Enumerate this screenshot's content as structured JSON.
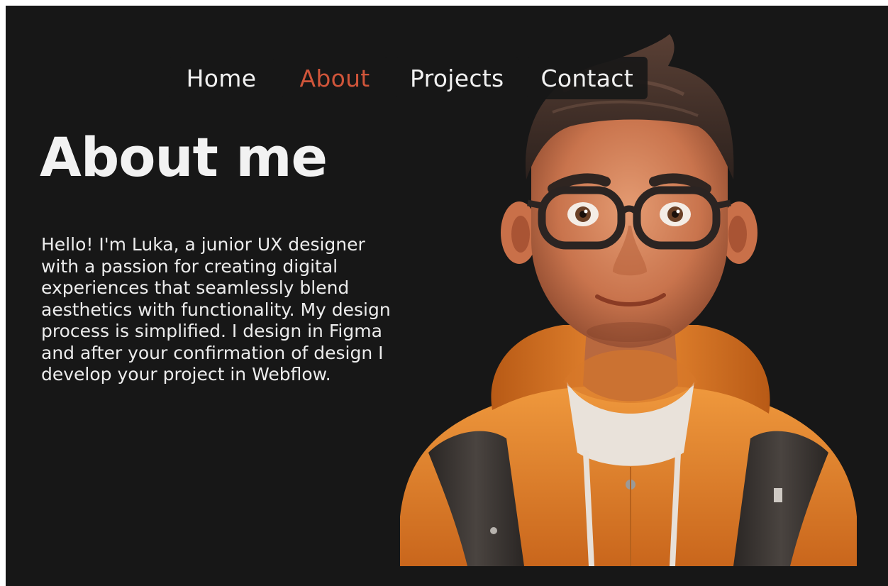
{
  "nav": {
    "items": [
      {
        "label": "Home",
        "active": false
      },
      {
        "label": "About",
        "active": true
      },
      {
        "label": "Projects",
        "active": false
      },
      {
        "label": "Contact",
        "active": false
      }
    ]
  },
  "hero": {
    "title": "About me",
    "bio": "Hello! I'm Luka, a junior UX designer with a passion for creating digital experiences that seamlessly blend aesthetics with functionality. My design process is simplified. I design in Figma and after your confirmation of design I develop your project in Webflow."
  },
  "colors": {
    "background": "#171717",
    "accent": "#d0553a",
    "text": "#f2f2f2",
    "hoodie": "#e8862e"
  },
  "icons": {
    "portrait": "3d-avatar-portrait"
  }
}
